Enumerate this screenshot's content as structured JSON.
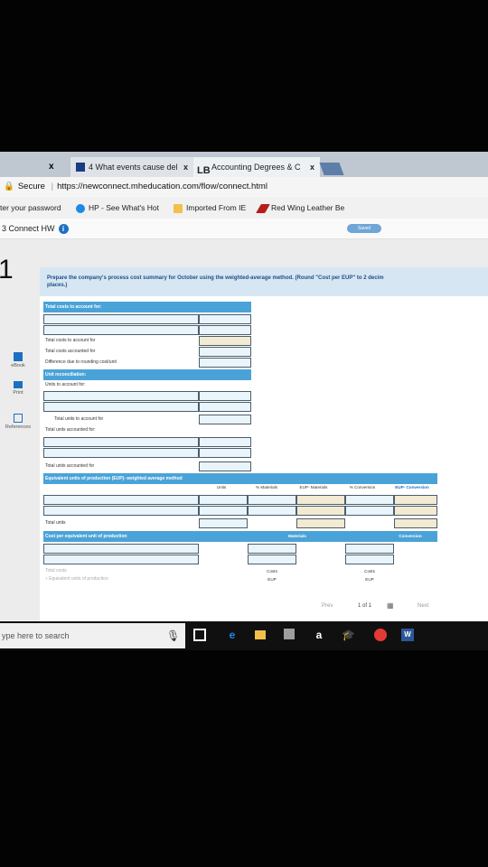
{
  "browser": {
    "tabs": [
      {
        "title": "4 What events cause del",
        "close": "x"
      },
      {
        "title": "Accounting Degrees & C",
        "close": "x"
      }
    ],
    "lone_close": "x",
    "address": {
      "secure_label": "Secure",
      "url": "https://newconnect.mheducation.com/flow/connect.html"
    },
    "bookmarks": [
      "ter your password",
      "HP - See What's Hot",
      "Imported From IE",
      "Red Wing Leather Be"
    ]
  },
  "app": {
    "title": "3 Connect HW",
    "saved_label": "Saved",
    "question_number": "1",
    "sidebar": [
      {
        "label": "eBook",
        "icon": "book-icon"
      },
      {
        "label": "Print",
        "icon": "print-icon"
      },
      {
        "label": "References",
        "icon": "references-icon"
      }
    ]
  },
  "prompt": {
    "text": "Prepare the company's process cost summary for October using the weighted-average method. (Round \"Cost per EUP\" to 2 decim",
    "text2": "places.)"
  },
  "table": {
    "sections": {
      "total_costs": "Total costs to account for:",
      "total_costs_to_account": "Total costs to account for",
      "total_costs_accounted": "Total costs accounted for",
      "difference": "Difference due to rounding cost/unit",
      "unit_reconciliation": "Unit reconciliation:",
      "units_to_account": "Units to account for:",
      "total_units_to_account": "Total units to account for",
      "total_units_accounted_colon": "Total units accounted for:",
      "total_units_accounted": "Total units accounted for",
      "eup_header": "Equivalent units of production (EUP)- weighted average method",
      "total_units": "Total units",
      "cost_per_eup_header": "Cost per equivalent unit of production",
      "total_costs_row": "Total costs",
      "equivalent_units_row": "÷ Equivalent units of production"
    },
    "eup_columns": [
      "Units",
      "% Materials",
      "EUP- Materials",
      "% Conversion",
      "EUP- Conversion"
    ],
    "cost_columns": {
      "materials": "Materials",
      "conversion": "Conversion"
    },
    "costs_label": "Costs",
    "eup_label": "EUP"
  },
  "pager": {
    "prev": "Prev",
    "position": "1 of 1",
    "next": "Next"
  },
  "taskbar": {
    "search_placeholder": "ype here to search"
  }
}
